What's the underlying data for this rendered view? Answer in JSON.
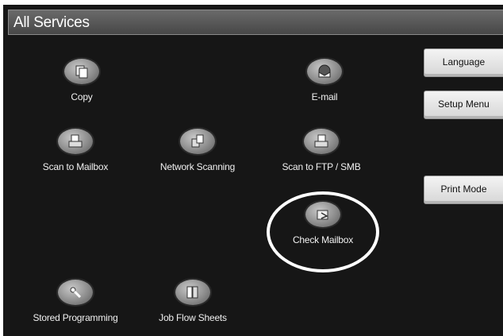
{
  "title": "All Services",
  "services": {
    "copy": {
      "label": "Copy",
      "icon": "copy-icon"
    },
    "email": {
      "label": "E-mail",
      "icon": "email-icon"
    },
    "scan_to_mailbox": {
      "label": "Scan to Mailbox",
      "icon": "scan-to-mailbox-icon"
    },
    "network_scanning": {
      "label": "Network Scanning",
      "icon": "network-scanning-icon"
    },
    "scan_to_ftp_smb": {
      "label": "Scan to FTP / SMB",
      "icon": "scan-to-ftp-icon"
    },
    "check_mailbox": {
      "label": "Check Mailbox",
      "icon": "check-mailbox-icon"
    },
    "stored_programming": {
      "label": "Stored Programming",
      "icon": "stored-programming-icon"
    },
    "job_flow_sheets": {
      "label": "Job Flow Sheets",
      "icon": "job-flow-sheets-icon"
    }
  },
  "side_buttons": {
    "language": "Language",
    "setup_menu": "Setup Menu",
    "print_mode": "Print Mode"
  },
  "colors": {
    "background": "#161616",
    "titlebar": "#555555",
    "button": "#e6e6e6",
    "highlight": "#ffffff"
  }
}
